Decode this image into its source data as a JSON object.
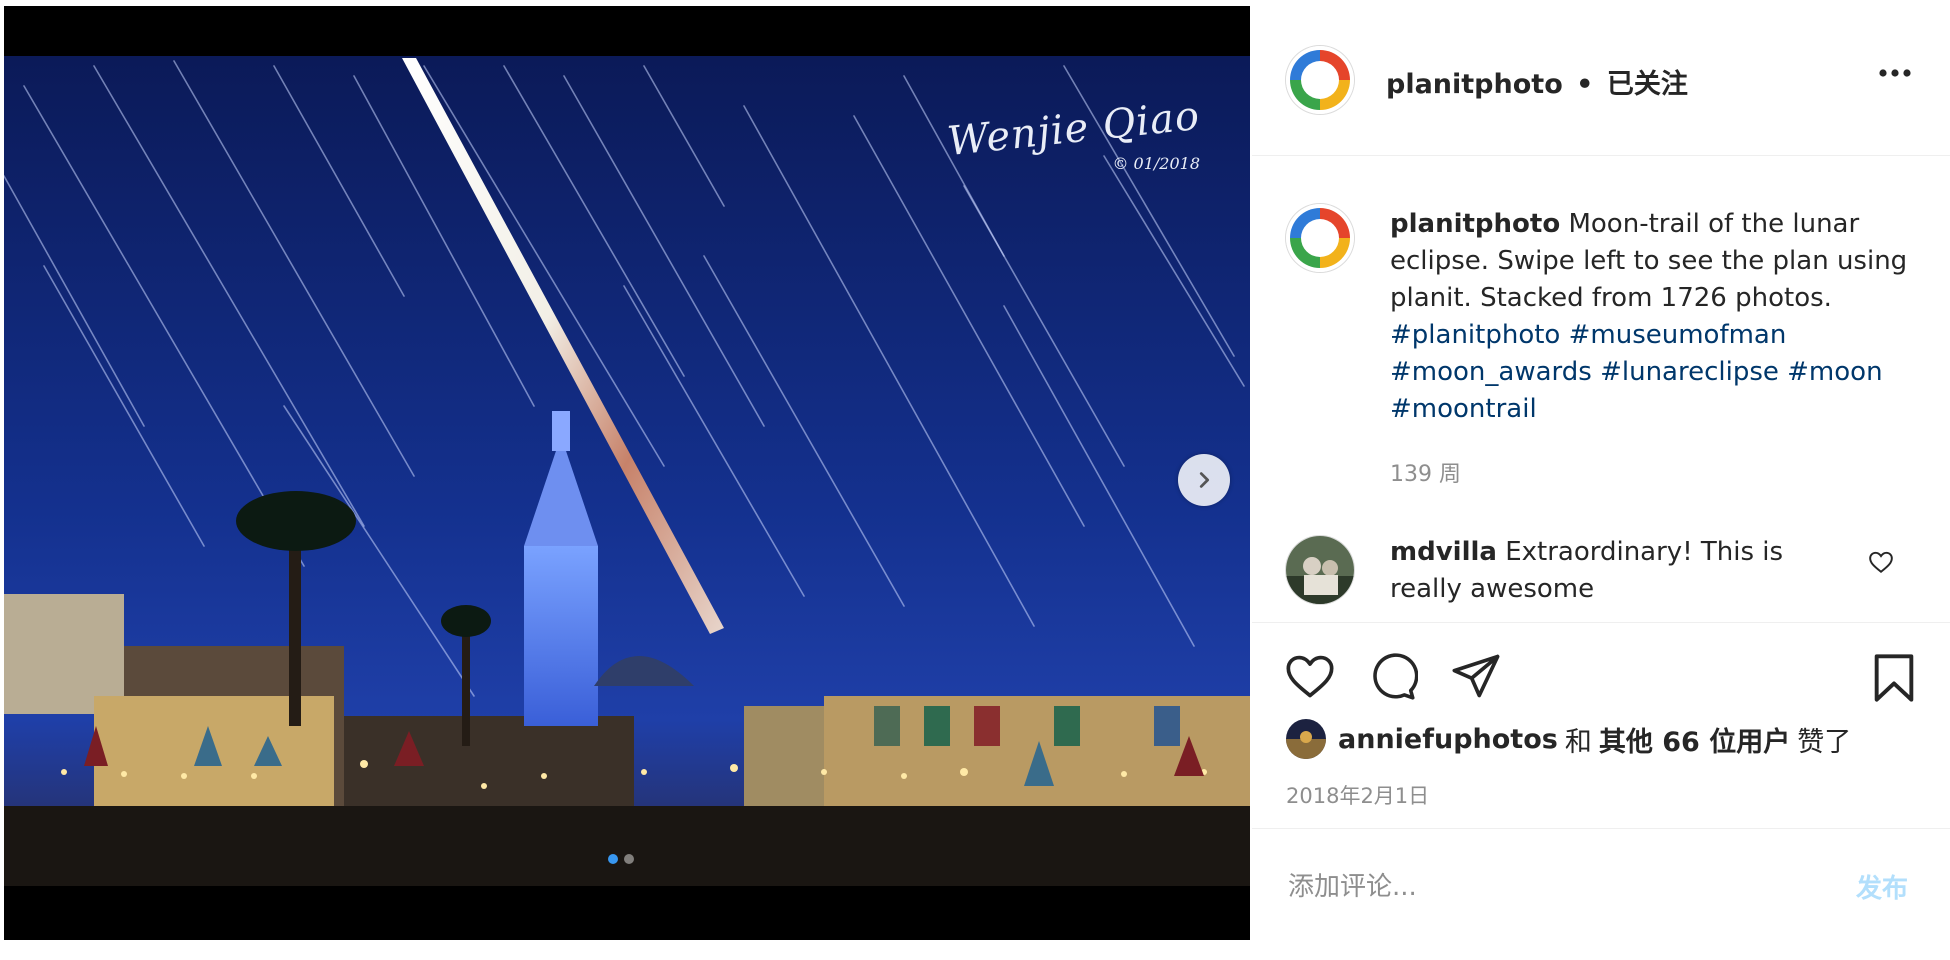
{
  "header": {
    "username": "planitphoto",
    "separator": "•",
    "follow_status": "已关注"
  },
  "media": {
    "signature_name": "Wenjie Qiao",
    "signature_date": "© 01/2018",
    "slide_count": 2,
    "active_slide": 1
  },
  "caption": {
    "username": "planitphoto",
    "text": "Moon-trail of the lunar eclipse. Swipe left to see the plan using planit. Stacked from 1726 photos.",
    "hashtags": "#planitphoto #museumofman #moon_awards #lunareclipse #moon #moontrail",
    "time": "139 周"
  },
  "comment": {
    "username": "mdvilla",
    "text": "Extraordinary! This is really awesome"
  },
  "likes": {
    "username": "anniefuphotos",
    "connector": "和",
    "others": "其他 66 位用户",
    "suffix": "赞了"
  },
  "date": "2018年2月1日",
  "add_comment": {
    "placeholder": "添加评论...",
    "post_label": "发布"
  },
  "colors": {
    "link": "#00376b",
    "post_button_disabled": "#b2dffc",
    "muted": "#8e8e8e"
  },
  "icons": {
    "more": "more-horizontal-icon",
    "next": "chevron-right-icon",
    "like": "heart-icon",
    "comment": "comment-bubble-icon",
    "share": "paper-plane-icon",
    "save": "bookmark-icon"
  }
}
